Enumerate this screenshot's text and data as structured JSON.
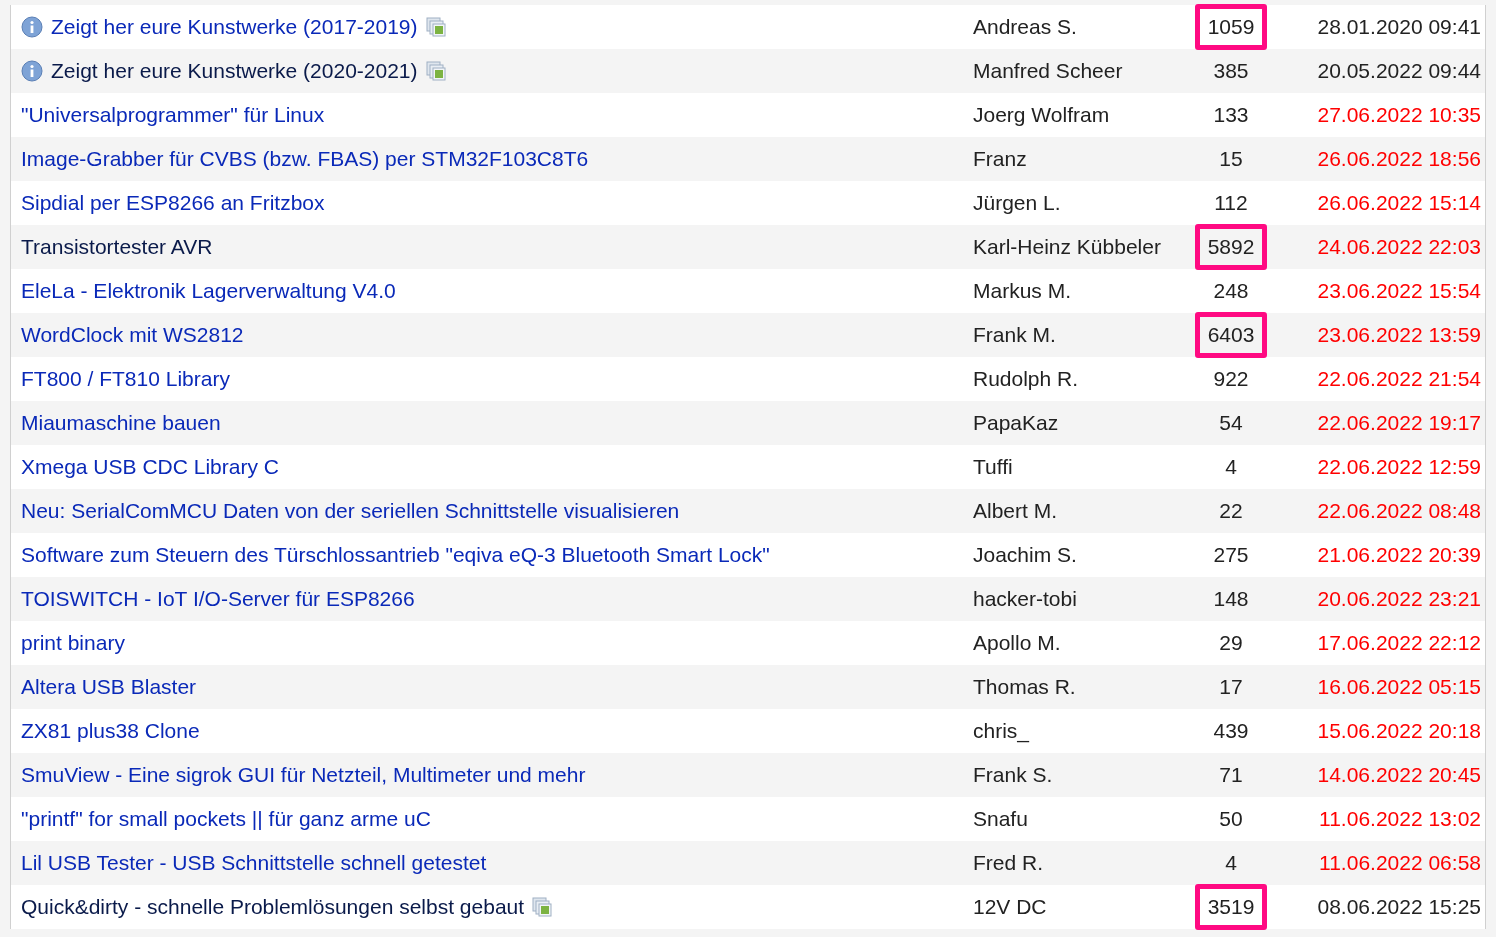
{
  "threads": [
    {
      "title": "Zeigt her eure Kunstwerke (2017-2019)",
      "info": true,
      "gallery": true,
      "visited": false,
      "author": "Andreas S.",
      "count": "1059",
      "highlighted": true,
      "date": "28.01.2020 09:41",
      "new": false
    },
    {
      "title": "Zeigt her eure Kunstwerke (2020-2021)",
      "info": true,
      "gallery": true,
      "visited": true,
      "author": "Manfred Scheer",
      "count": "385",
      "highlighted": false,
      "date": "20.05.2022 09:44",
      "new": false
    },
    {
      "title": "\"Universalprogrammer\" für Linux",
      "info": false,
      "gallery": false,
      "visited": false,
      "author": "Joerg Wolfram",
      "count": "133",
      "highlighted": false,
      "date": "27.06.2022 10:35",
      "new": true
    },
    {
      "title": "Image-Grabber für CVBS (bzw. FBAS) per STM32F103C8T6",
      "info": false,
      "gallery": false,
      "visited": false,
      "author": "Franz",
      "count": "15",
      "highlighted": false,
      "date": "26.06.2022 18:56",
      "new": true
    },
    {
      "title": "Sipdial per ESP8266 an Fritzbox",
      "info": false,
      "gallery": false,
      "visited": false,
      "author": "Jürgen L.",
      "count": "112",
      "highlighted": false,
      "date": "26.06.2022 15:14",
      "new": true
    },
    {
      "title": "Transistortester AVR",
      "info": false,
      "gallery": false,
      "visited": true,
      "author": "Karl-Heinz Kübbeler",
      "count": "5892",
      "highlighted": true,
      "date": "24.06.2022 22:03",
      "new": true
    },
    {
      "title": "EleLa - Elektronik Lagerverwaltung V4.0",
      "info": false,
      "gallery": false,
      "visited": false,
      "author": "Markus M.",
      "count": "248",
      "highlighted": false,
      "date": "23.06.2022 15:54",
      "new": true
    },
    {
      "title": "WordClock mit WS2812",
      "info": false,
      "gallery": false,
      "visited": false,
      "author": "Frank M.",
      "count": "6403",
      "highlighted": true,
      "date": "23.06.2022 13:59",
      "new": true
    },
    {
      "title": "FT800 / FT810 Library",
      "info": false,
      "gallery": false,
      "visited": false,
      "author": "Rudolph R.",
      "count": "922",
      "highlighted": false,
      "date": "22.06.2022 21:54",
      "new": true
    },
    {
      "title": "Miaumaschine bauen",
      "info": false,
      "gallery": false,
      "visited": false,
      "author": "PapaKaz",
      "count": "54",
      "highlighted": false,
      "date": "22.06.2022 19:17",
      "new": true
    },
    {
      "title": "Xmega USB CDC Library C",
      "info": false,
      "gallery": false,
      "visited": false,
      "author": "Tuffi",
      "count": "4",
      "highlighted": false,
      "date": "22.06.2022 12:59",
      "new": true
    },
    {
      "title": "Neu: SerialComMCU Daten von der seriellen Schnittstelle visualisieren",
      "info": false,
      "gallery": false,
      "visited": false,
      "author": "Albert M.",
      "count": "22",
      "highlighted": false,
      "date": "22.06.2022 08:48",
      "new": true
    },
    {
      "title": "Software zum Steuern des Türschlossantrieb \"eqiva eQ-3 Bluetooth Smart Lock\"",
      "info": false,
      "gallery": false,
      "visited": false,
      "author": "Joachim S.",
      "count": "275",
      "highlighted": false,
      "date": "21.06.2022 20:39",
      "new": true
    },
    {
      "title": "TOISWITCH - IoT I/O-Server für ESP8266",
      "info": false,
      "gallery": false,
      "visited": false,
      "author": "hacker-tobi",
      "count": "148",
      "highlighted": false,
      "date": "20.06.2022 23:21",
      "new": true
    },
    {
      "title": "print binary",
      "info": false,
      "gallery": false,
      "visited": false,
      "author": "Apollo M.",
      "count": "29",
      "highlighted": false,
      "date": "17.06.2022 22:12",
      "new": true
    },
    {
      "title": "Altera USB Blaster",
      "info": false,
      "gallery": false,
      "visited": false,
      "author": "Thomas R.",
      "count": "17",
      "highlighted": false,
      "date": "16.06.2022 05:15",
      "new": true
    },
    {
      "title": "ZX81 plus38 Clone",
      "info": false,
      "gallery": false,
      "visited": false,
      "author": "chris_",
      "count": "439",
      "highlighted": false,
      "date": "15.06.2022 20:18",
      "new": true
    },
    {
      "title": "SmuView - Eine sigrok GUI für Netzteil, Multimeter und mehr",
      "info": false,
      "gallery": false,
      "visited": false,
      "author": "Frank S.",
      "count": "71",
      "highlighted": false,
      "date": "14.06.2022 20:45",
      "new": true
    },
    {
      "title": "\"printf\" for small pockets || für ganz arme uC",
      "info": false,
      "gallery": false,
      "visited": false,
      "author": "Snafu",
      "count": "50",
      "highlighted": false,
      "date": "11.06.2022 13:02",
      "new": true
    },
    {
      "title": "Lil USB Tester - USB Schnittstelle schnell getestet",
      "info": false,
      "gallery": false,
      "visited": false,
      "author": "Fred R.",
      "count": "4",
      "highlighted": false,
      "date": "11.06.2022 06:58",
      "new": true
    },
    {
      "title": "Quick&dirty - schnelle Problemlösungen selbst gebaut",
      "info": false,
      "gallery": true,
      "visited": true,
      "author": "12V DC",
      "count": "3519",
      "highlighted": true,
      "date": "08.06.2022 15:25",
      "new": false
    }
  ]
}
